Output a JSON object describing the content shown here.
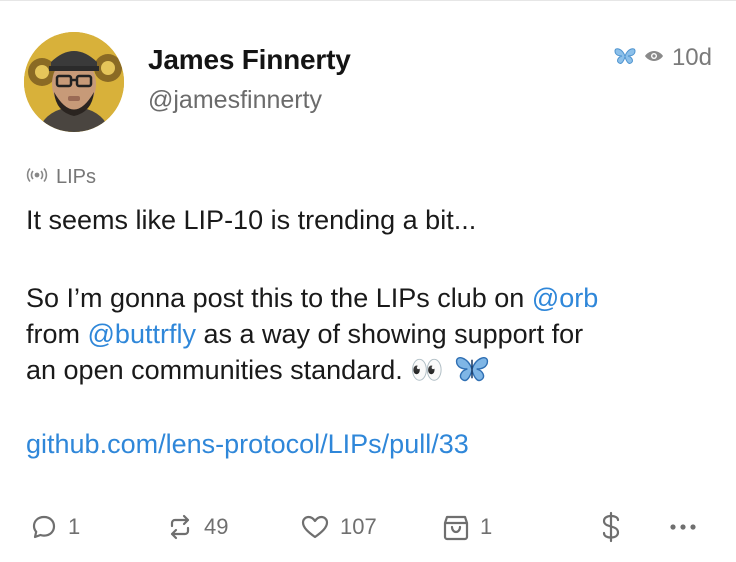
{
  "post": {
    "author_name": "James Finnerty",
    "author_handle": "@jamesfinnerty",
    "age": "10d",
    "club_name": "LIPs",
    "text_line1": "It seems like LIP-10 is trending a bit...",
    "text_p2_a": "So I’m gonna post this to the LIPs club on ",
    "mention_orb": "@orb",
    "text_p2_b": "from ",
    "mention_buttrfly": "@buttrfly",
    "text_p2_c": " as a way of showing support for",
    "text_p2_d": "an open communities standard. ",
    "emoji": "👀",
    "link": "github.com/lens-protocol/LIPs/pull/33"
  },
  "actions": {
    "comments": "1",
    "mirrors": "49",
    "likes": "107",
    "collects": "1"
  },
  "icons": {
    "comment": "comment-icon",
    "mirror": "mirror-icon",
    "like": "heart-icon",
    "collect": "collect-icon",
    "tip": "dollar-icon",
    "more": "more-icon",
    "client": "butterfly-icon",
    "lens": "lens-icon",
    "club": "broadcast-icon"
  },
  "colors": {
    "accent": "#2f87d9",
    "muted": "#6f6f6f"
  }
}
